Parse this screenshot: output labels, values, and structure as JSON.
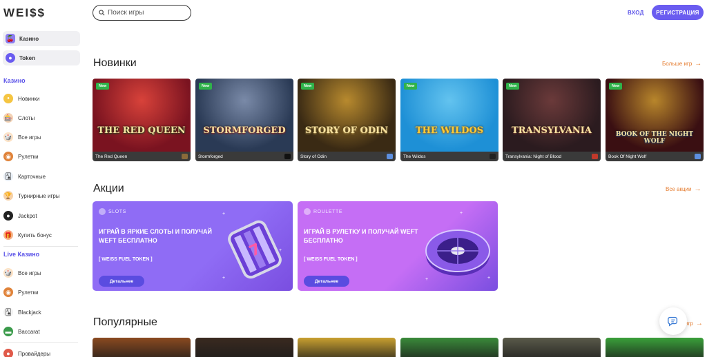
{
  "header": {
    "logo": "WEI$$",
    "search_placeholder": "Поиск игры",
    "login_label": "ВХОД",
    "register_label": "РЕГИСТРАЦИЯ"
  },
  "sidebar": {
    "top_items": [
      {
        "label": "Казино",
        "icon": "cherry-icon"
      },
      {
        "label": "Token",
        "icon": "token-icon"
      }
    ],
    "casino_title": "Казино",
    "casino_items": [
      {
        "label": "Новинки",
        "icon": "new-icon"
      },
      {
        "label": "Слоты",
        "icon": "slots-icon"
      },
      {
        "label": "Все игры",
        "icon": "all-games-icon"
      },
      {
        "label": "Рулетки",
        "icon": "roulette-icon"
      },
      {
        "label": "Карточные",
        "icon": "cards-icon"
      },
      {
        "label": "Турнирные игры",
        "icon": "tournament-icon"
      },
      {
        "label": "Jackpot",
        "icon": "jackpot-icon"
      },
      {
        "label": "Купить бонус",
        "icon": "bonus-icon"
      }
    ],
    "live_title": "Live Казино",
    "live_items": [
      {
        "label": "Все игры",
        "icon": "all-games-icon"
      },
      {
        "label": "Рулетки",
        "icon": "roulette-icon"
      },
      {
        "label": "Blackjack",
        "icon": "blackjack-icon"
      },
      {
        "label": "Baccarat",
        "icon": "baccarat-icon"
      }
    ],
    "providers_label": "Провайдеры"
  },
  "new_section": {
    "title": "Новинки",
    "more_label": "Больше игр",
    "badge": "New",
    "games": [
      {
        "name": "The Red Queen",
        "art": "THE RED QUEEN",
        "colors": [
          "#7a1320",
          "#d8423a",
          "#2d6a2f"
        ],
        "prov_color": "#8a6a3a"
      },
      {
        "name": "Stormforged",
        "art": "STORMFORGED",
        "colors": [
          "#2a3a55",
          "#7a8aa8",
          "#c0392b"
        ],
        "prov_color": "#111111"
      },
      {
        "name": "Story of Odin",
        "art": "STORY OF ODIN",
        "colors": [
          "#3a2a14",
          "#b88a2e",
          "#e9c46a"
        ],
        "prov_color": "#5d8fe0"
      },
      {
        "name": "The Wildos",
        "art": "THE WILDOS",
        "colors": [
          "#1e90d6",
          "#63c3ef",
          "#e08a1c"
        ],
        "prov_color": "#222222"
      },
      {
        "name": "Transylvania: Night of Blood",
        "art": "TRANSYLVANIA",
        "colors": [
          "#2b1b1f",
          "#6b3a3a",
          "#a85a4a"
        ],
        "prov_color": "#c0392b"
      },
      {
        "name": "Book Of Night Wolf",
        "art": "BOOK OF THE NIGHT WOLF",
        "colors": [
          "#3a0f12",
          "#b8862b",
          "#2a5f9e"
        ],
        "prov_color": "#5d8fe0"
      }
    ]
  },
  "promos_section": {
    "title": "Акции",
    "more_label": "Все акции",
    "promos": [
      {
        "category": "SLOTS",
        "headline": "ИГРАЙ В ЯРКИЕ СЛОТЫ И ПОЛУЧАЙ WEFT БЕСПЛАТНО",
        "token": "[ WEISS FUEL TOKEN ]",
        "button": "Детальнее",
        "color": "#8f6cf5"
      },
      {
        "category": "ROULETTE",
        "headline": "ИГРАЙ В РУЛЕТКУ И ПОЛУЧАЙ WEFT БЕСПЛАТНО",
        "token": "[ WEISS FUEL TOKEN ]",
        "button": "Детальнее",
        "color": "#c56ef5"
      }
    ]
  },
  "popular_section": {
    "title": "Популярные",
    "more_label": "игр",
    "colors": [
      "#8a4a20",
      "#3a2a20",
      "#c9a030",
      "#3a8a3a",
      "#5a5a4a",
      "#3aa03a"
    ]
  }
}
